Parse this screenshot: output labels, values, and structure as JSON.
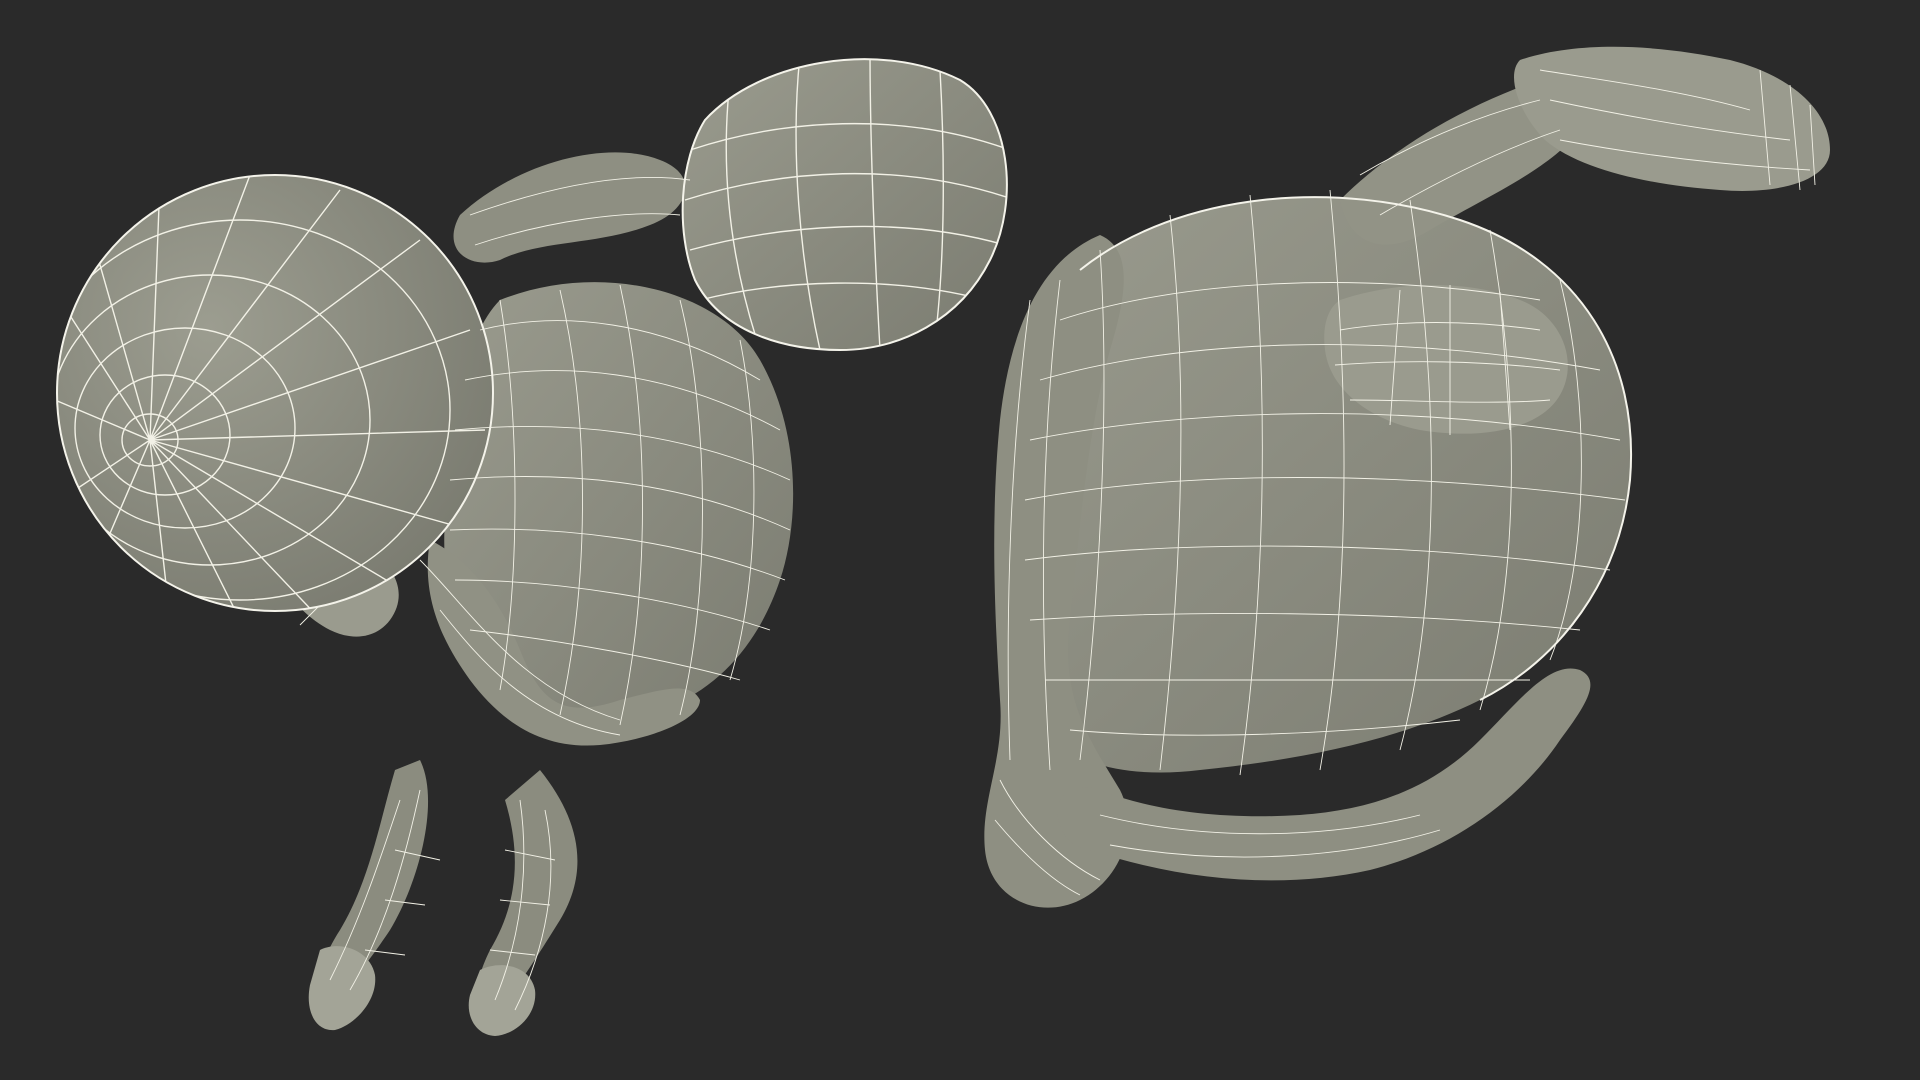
{
  "scene": {
    "background_color": "#2a2a2a",
    "model_color": "#8b8c7f",
    "wireframe_color": "#f2f1e6",
    "views": [
      {
        "name": "top-view-figure-with-ball"
      },
      {
        "name": "bottom-view-figure-with-ball"
      }
    ]
  }
}
